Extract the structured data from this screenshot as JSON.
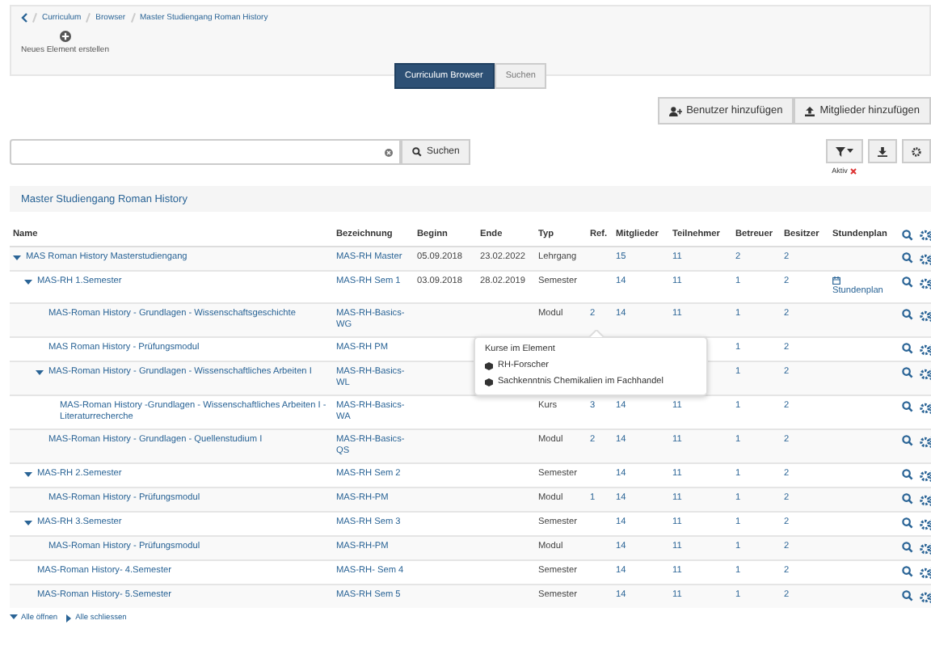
{
  "breadcrumb": [
    "Curriculum",
    "Browser",
    "Master Studiengang Roman History"
  ],
  "create_button": {
    "label": "Neues Element erstellen"
  },
  "tabs": [
    {
      "label": "Curriculum Browser",
      "selected": true
    },
    {
      "label": "Suchen",
      "selected": false
    }
  ],
  "actions": [
    {
      "label": "Benutzer hinzufügen",
      "kind": "user"
    },
    {
      "label": "Mitglieder hinzufügen",
      "kind": "upload"
    }
  ],
  "search": {
    "button": "Suchen"
  },
  "filter": {
    "label": "Aktiv"
  },
  "panel_title": "Master Studiengang Roman History",
  "table": {
    "columns": [
      "Name",
      "Bezeichnung",
      "Beginn",
      "Ende",
      "Typ",
      "Ref.",
      "Mitglieder",
      "Teilnehmer",
      "Betreuer",
      "Besitzer",
      "Stundenplan"
    ],
    "rows": [
      {
        "name": "MAS Roman History Masterstudiengang",
        "bezeichnung": "MAS-RH Master",
        "beginn": "05.09.2018",
        "ende": "23.02.2022",
        "typ": "Lehrgang",
        "mitglieder": "15",
        "teilnehmer": "11",
        "betreuer": "2",
        "besitzer": "2",
        "expanded": true,
        "children": [
          {
            "name": "MAS-RH 1.Semester",
            "bezeichnung": "MAS-RH Sem 1",
            "beginn": "03.09.2018",
            "ende": "28.02.2019",
            "typ": "Semester",
            "mitglieder": "14",
            "teilnehmer": "11",
            "betreuer": "1",
            "besitzer": "2",
            "stundenplan": "Stundenplan",
            "expanded": true,
            "children": [
              {
                "name": "MAS-Roman History - Grundlagen - Wissenschaftsgeschichte",
                "bezeichnung": "MAS-RH-Basics-WG",
                "typ": "Modul",
                "ref": "2",
                "mitglieder": "14",
                "teilnehmer": "11",
                "betreuer": "1",
                "besitzer": "2"
              },
              {
                "name": "MAS Roman History - Prüfungsmodul",
                "bezeichnung": "MAS-RH PM",
                "betreuer": "1",
                "besitzer": "2"
              },
              {
                "name": "MAS-Roman History - Grundlagen - Wissenschaftliches Arbeiten I",
                "bezeichnung": "MAS-RH-Basics-WL",
                "betreuer": "1",
                "besitzer": "2",
                "expanded": true,
                "children": [
                  {
                    "name": "MAS-Roman History -Grundlagen - Wissenschaftliches Arbeiten I - Literaturrecherche",
                    "bezeichnung": "MAS-RH-Basics-WA",
                    "typ": "Kurs",
                    "ref": "3",
                    "mitglieder": "14",
                    "teilnehmer": "11",
                    "betreuer": "1",
                    "besitzer": "2"
                  }
                ]
              },
              {
                "name": "MAS-Roman History - Grundlagen - Quellenstudium I",
                "bezeichnung": "MAS-RH-Basics-QS",
                "typ": "Modul",
                "ref": "2",
                "mitglieder": "14",
                "teilnehmer": "11",
                "betreuer": "1",
                "besitzer": "2"
              }
            ]
          },
          {
            "name": "MAS-RH 2.Semester",
            "bezeichnung": "MAS-RH Sem 2",
            "typ": "Semester",
            "mitglieder": "14",
            "teilnehmer": "11",
            "betreuer": "1",
            "besitzer": "2",
            "expanded": true,
            "children": [
              {
                "name": "MAS-Roman History - Prüfungsmodul",
                "bezeichnung": "MAS-RH-PM",
                "typ": "Modul",
                "ref": "1",
                "mitglieder": "14",
                "teilnehmer": "11",
                "betreuer": "1",
                "besitzer": "2"
              }
            ]
          },
          {
            "name": "MAS-RH 3.Semester",
            "bezeichnung": "MAS-RH Sem 3",
            "typ": "Semester",
            "mitglieder": "14",
            "teilnehmer": "11",
            "betreuer": "1",
            "besitzer": "2",
            "expanded": true,
            "children": [
              {
                "name": "MAS-Roman History - Prüfungsmodul",
                "bezeichnung": "MAS-RH-PM",
                "typ": "Modul",
                "mitglieder": "14",
                "teilnehmer": "11",
                "betreuer": "1",
                "besitzer": "2"
              }
            ]
          },
          {
            "name": "MAS-Roman History- 4.Semester",
            "bezeichnung": "MAS-RH- Sem 4",
            "typ": "Semester",
            "mitglieder": "14",
            "teilnehmer": "11",
            "betreuer": "1",
            "besitzer": "2"
          },
          {
            "name": "MAS-Roman History- 5.Semester",
            "bezeichnung": "MAS-RH Sem 5",
            "typ": "Semester",
            "mitglieder": "14",
            "teilnehmer": "11",
            "betreuer": "1",
            "besitzer": "2"
          }
        ]
      }
    ]
  },
  "popover": {
    "title": "Kurse im Element",
    "items": [
      "RH-Forscher",
      "Sachkenntnis Chemikalien im Fachhandel"
    ]
  },
  "footer": {
    "expand_all": "Alle öffnen",
    "collapse_all": "Alle schliessen"
  }
}
